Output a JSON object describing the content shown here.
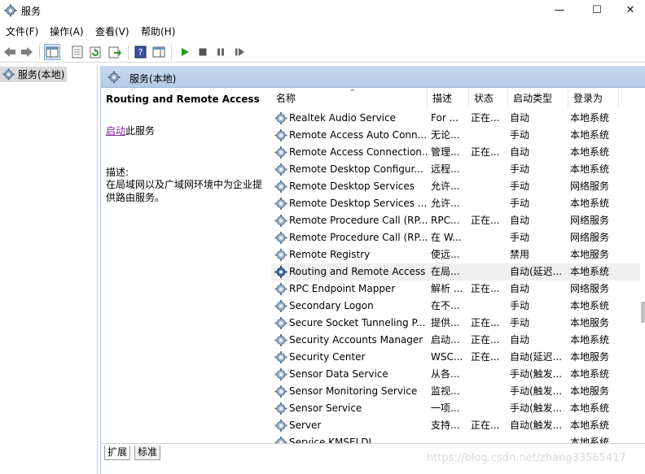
{
  "window": {
    "title": "服务",
    "icon": "gear-icon"
  },
  "window_controls": {
    "minimize": "—",
    "maximize": "☐",
    "close": "✕"
  },
  "menu": {
    "items": [
      "文件(F)",
      "操作(A)",
      "查看(V)",
      "帮助(H)"
    ]
  },
  "toolbar": {
    "buttons": [
      "back-arrow-icon",
      "forward-arrow-icon",
      "show-hide-console-tree-icon",
      "properties-icon",
      "refresh-icon",
      "export-list-icon",
      "help-icon",
      "show-action-pane-icon",
      "play-icon",
      "stop-icon",
      "pause-icon",
      "resume-icon"
    ]
  },
  "tree": {
    "item": "服务(本地)"
  },
  "panel": {
    "header": "服务(本地)"
  },
  "details": {
    "service_name": "Routing and Remote Access",
    "start_link": "启动",
    "start_suffix": "此服务",
    "desc_label": "描述:",
    "desc_text": "在局域网以及广域网环境中为企业提供路由服务。"
  },
  "columns": {
    "name": "名称",
    "desc": "描述",
    "status": "状态",
    "startup": "启动类型",
    "logon": "登录为"
  },
  "services": [
    {
      "name": "Realtek Audio Service",
      "desc": "For ...",
      "status": "正在...",
      "startup": "自动",
      "logon": "本地系统"
    },
    {
      "name": "Remote Access Auto Conn...",
      "desc": "无论...",
      "status": "",
      "startup": "手动",
      "logon": "本地系统"
    },
    {
      "name": "Remote Access Connection...",
      "desc": "管理...",
      "status": "正在...",
      "startup": "自动",
      "logon": "本地系统"
    },
    {
      "name": "Remote Desktop Configur...",
      "desc": "远程...",
      "status": "",
      "startup": "手动",
      "logon": "本地系统"
    },
    {
      "name": "Remote Desktop Services",
      "desc": "允许...",
      "status": "",
      "startup": "手动",
      "logon": "网络服务"
    },
    {
      "name": "Remote Desktop Services ...",
      "desc": "允许...",
      "status": "",
      "startup": "手动",
      "logon": "本地系统"
    },
    {
      "name": "Remote Procedure Call (RP...",
      "desc": "RPC...",
      "status": "正在...",
      "startup": "自动",
      "logon": "网络服务"
    },
    {
      "name": "Remote Procedure Call (RP...",
      "desc": "在 W...",
      "status": "",
      "startup": "手动",
      "logon": "网络服务"
    },
    {
      "name": "Remote Registry",
      "desc": "使远...",
      "status": "",
      "startup": "禁用",
      "logon": "本地服务"
    },
    {
      "name": "Routing and Remote Access",
      "desc": "在局...",
      "status": "",
      "startup": "自动(延迟...",
      "logon": "本地系统"
    },
    {
      "name": "RPC Endpoint Mapper",
      "desc": "解析 ...",
      "status": "正在...",
      "startup": "自动",
      "logon": "网络服务"
    },
    {
      "name": "Secondary Logon",
      "desc": "在不...",
      "status": "",
      "startup": "手动",
      "logon": "本地系统"
    },
    {
      "name": "Secure Socket Tunneling P...",
      "desc": "提供...",
      "status": "正在...",
      "startup": "手动",
      "logon": "本地服务"
    },
    {
      "name": "Security Accounts Manager",
      "desc": "启动...",
      "status": "正在...",
      "startup": "自动",
      "logon": "本地系统"
    },
    {
      "name": "Security Center",
      "desc": "WSC...",
      "status": "正在...",
      "startup": "自动(延迟...",
      "logon": "本地服务"
    },
    {
      "name": "Sensor Data Service",
      "desc": "从各...",
      "status": "",
      "startup": "手动(触发...",
      "logon": "本地系统"
    },
    {
      "name": "Sensor Monitoring Service",
      "desc": "监视...",
      "status": "",
      "startup": "手动(触发...",
      "logon": "本地服务"
    },
    {
      "name": "Sensor Service",
      "desc": "一项...",
      "status": "",
      "startup": "手动(触发...",
      "logon": "本地系统"
    },
    {
      "name": "Server",
      "desc": "支持...",
      "status": "正在...",
      "startup": "自动(触发...",
      "logon": "本地系统"
    },
    {
      "name": "Service KMSELDI",
      "desc": "",
      "status": "",
      "startup": "",
      "logon": "本地系统"
    }
  ],
  "selected_service_index": 9,
  "tabs": [
    "扩展",
    "标准"
  ],
  "watermark": "https://blog.csdn.net/zhang33565417"
}
